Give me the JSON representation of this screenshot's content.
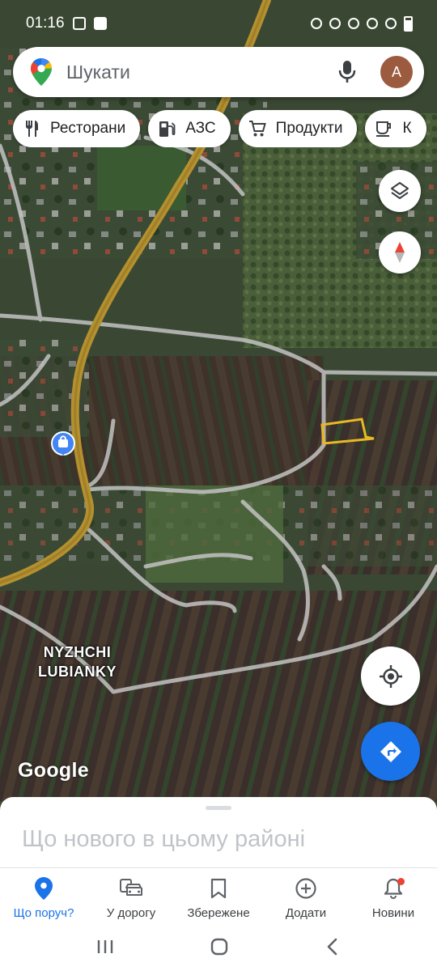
{
  "status_bar": {
    "time": "01:16"
  },
  "search": {
    "placeholder": "Шукати",
    "avatar_letter": "A"
  },
  "chips": [
    {
      "label": "Ресторани",
      "icon": "restaurant-icon"
    },
    {
      "label": "АЗС",
      "icon": "gas-station-icon"
    },
    {
      "label": "Продукти",
      "icon": "cart-icon"
    },
    {
      "label": "К",
      "icon": "coffee-icon"
    }
  ],
  "map": {
    "place_label_line1": "NYZHCHI",
    "place_label_line2": "LUBIANKY",
    "attribution": "Google",
    "colors": {
      "road_major": "#b4902f",
      "road_minor": "#c3c3c3",
      "parcel_outline": "#e8b825"
    }
  },
  "sheet": {
    "title": "Що нового в цьому районі"
  },
  "nav": [
    {
      "label": "Що поруч?",
      "icon": "explore-pin-icon",
      "active": true
    },
    {
      "label": "У дорогу",
      "icon": "commute-icon",
      "active": false
    },
    {
      "label": "Збережене",
      "icon": "bookmark-icon",
      "active": false
    },
    {
      "label": "Додати",
      "icon": "add-circle-icon",
      "active": false
    },
    {
      "label": "Новини",
      "icon": "bell-icon",
      "active": false
    }
  ],
  "accent_color": "#1a73e8"
}
